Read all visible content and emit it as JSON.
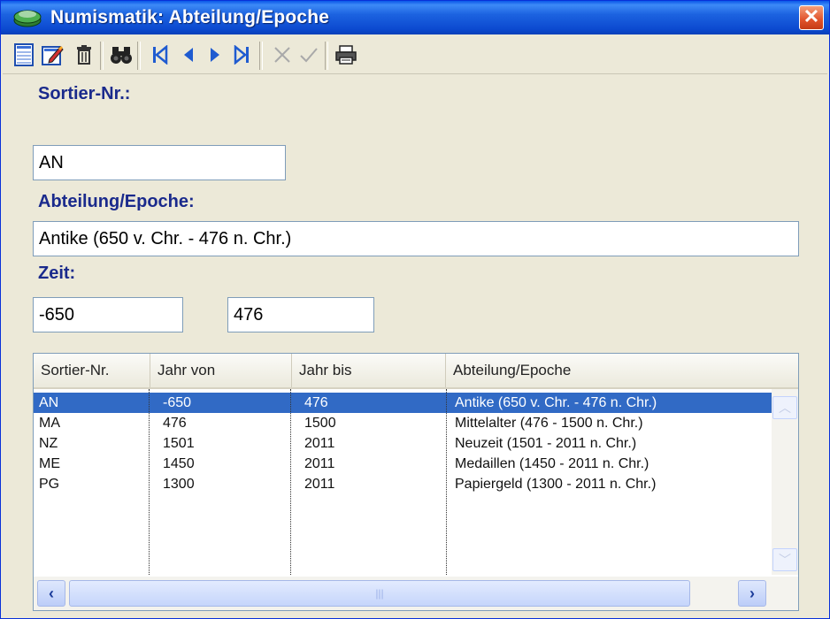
{
  "window": {
    "title": "Numismatik: Abteilung/Epoche",
    "close_symbol": "✕"
  },
  "toolbar": {
    "icons": [
      "list-icon",
      "edit-icon",
      "delete-icon",
      "binoculars-icon",
      "first-record-icon",
      "prev-record-icon",
      "next-record-icon",
      "last-record-icon",
      "cancel-icon",
      "confirm-icon",
      "print-icon"
    ]
  },
  "form": {
    "sortier_label": "Sortier-Nr.:",
    "sortier_value": "AN",
    "abteilung_label": "Abteilung/Epoche:",
    "abteilung_value": "Antike (650 v. Chr. - 476 n. Chr.)",
    "zeit_label": "Zeit:",
    "zeit_von": "-650",
    "zeit_bis": "476"
  },
  "grid": {
    "columns": [
      "Sortier-Nr.",
      "Jahr von",
      "Jahr bis",
      "Abteilung/Epoche"
    ],
    "rows": [
      {
        "sortier": "AN",
        "von": "-650",
        "bis": "476",
        "epoche": "Antike (650 v. Chr. - 476 n. Chr.)",
        "selected": true
      },
      {
        "sortier": "MA",
        "von": "476",
        "bis": "1500",
        "epoche": "Mittelalter (476 - 1500 n. Chr.)",
        "selected": false
      },
      {
        "sortier": "NZ",
        "von": "1501",
        "bis": "2011",
        "epoche": "Neuzeit (1501 - 2011 n. Chr.)",
        "selected": false
      },
      {
        "sortier": "ME",
        "von": "1450",
        "bis": "2011",
        "epoche": "Medaillen (1450 - 2011 n. Chr.)",
        "selected": false
      },
      {
        "sortier": "PG",
        "von": "1300",
        "bis": "2011",
        "epoche": "Papiergeld (1300 - 2011 n. Chr.)",
        "selected": false
      }
    ]
  },
  "colors": {
    "accent": "#316ac5",
    "label": "#1a2a8c",
    "title_bar": "#0b49cf"
  }
}
